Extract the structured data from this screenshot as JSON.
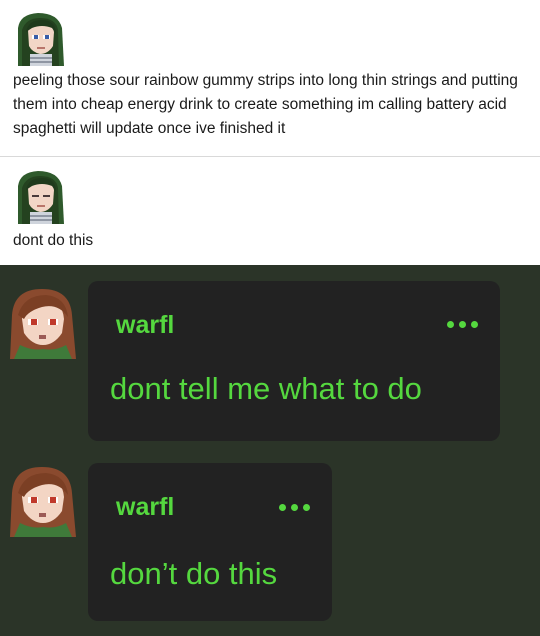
{
  "posts": [
    {
      "avatar_icon": "pixel-portrait-green-hood",
      "text": "peeling those sour rainbow gummy strips into long thin strings and putting them into cheap energy drink to create something im calling battery acid spaghetti will update once ive finished it"
    },
    {
      "avatar_icon": "pixel-portrait-green-hood",
      "text": "dont do this"
    }
  ],
  "chat": {
    "background": "#2b3428",
    "bubble_color": "#222222",
    "accent_color": "#55d83f",
    "messages": [
      {
        "avatar_icon": "pixel-portrait-red-eyes",
        "username": "warfl",
        "text": "dont tell me what to do",
        "menu_icon": "more-dots-icon"
      },
      {
        "avatar_icon": "pixel-portrait-red-eyes",
        "username": "warfl",
        "text": "don’t do this",
        "menu_icon": "more-dots-icon"
      }
    ]
  }
}
